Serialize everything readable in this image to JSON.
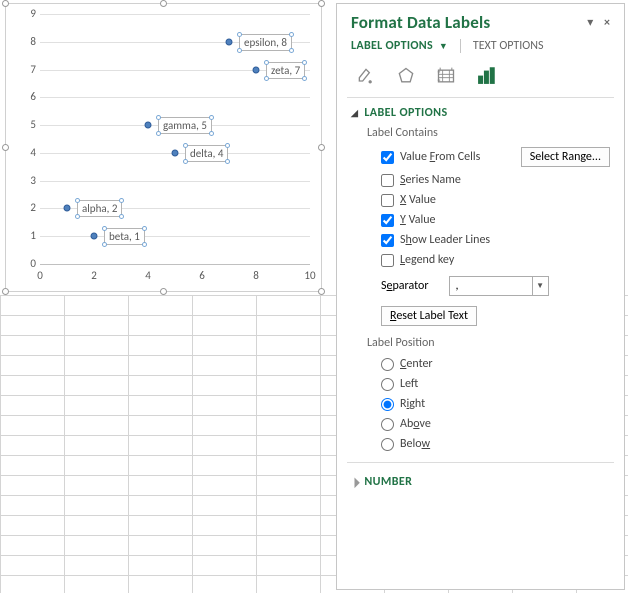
{
  "chart_data": {
    "type": "scatter",
    "title": "",
    "xlabel": "",
    "ylabel": "",
    "xlim": [
      0,
      10
    ],
    "ylim": [
      0,
      9
    ],
    "x_ticks": [
      0,
      2,
      4,
      6,
      8,
      10
    ],
    "y_ticks": [
      0,
      1,
      2,
      3,
      4,
      5,
      6,
      7,
      8,
      9
    ],
    "points": [
      {
        "name": "alpha",
        "x": 1,
        "y": 2,
        "label": "alpha, 2"
      },
      {
        "name": "beta",
        "x": 2,
        "y": 1,
        "label": "beta, 1"
      },
      {
        "name": "gamma",
        "x": 4,
        "y": 5,
        "label": "gamma, 5"
      },
      {
        "name": "delta",
        "x": 5,
        "y": 4,
        "label": "delta, 4"
      },
      {
        "name": "epsilon",
        "x": 7,
        "y": 8,
        "label": "epsilon, 8"
      },
      {
        "name": "zeta",
        "x": 8,
        "y": 7,
        "label": "zeta, 7"
      }
    ]
  },
  "panel": {
    "title": "Format Data Labels",
    "tabs": {
      "label_options": "LABEL OPTIONS",
      "text_options": "TEXT OPTIONS"
    },
    "sections": {
      "label_options_head": "LABEL OPTIONS",
      "label_contains": "Label Contains",
      "label_position": "Label Position",
      "number": "NUMBER"
    },
    "options": {
      "value_from_cells": "Value From Cells",
      "series_name": "Series Name",
      "x_value": "X Value",
      "y_value": "Y Value",
      "show_leader": "Show Leader Lines",
      "legend_key": "Legend key"
    },
    "buttons": {
      "select_range": "Select Range...",
      "reset_label": "Reset Label Text"
    },
    "separator": {
      "label": "Separator",
      "value": ","
    },
    "position": {
      "center": "Center",
      "left": "Left",
      "right": "Right",
      "above": "Above",
      "below": "Below"
    },
    "state": {
      "value_from_cells": true,
      "series_name": false,
      "x_value": false,
      "y_value": true,
      "show_leader": true,
      "legend_key": false,
      "position_selected": "right"
    }
  }
}
